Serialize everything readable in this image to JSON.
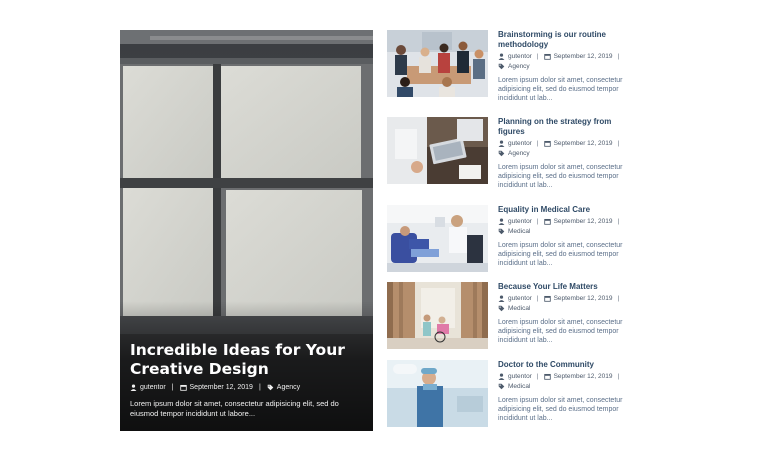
{
  "featured": {
    "title": "Incredible Ideas for Your Creative Design",
    "author": "gutentor",
    "date": "September 12, 2019",
    "category": "Agency",
    "excerpt": "Lorem ipsum dolor sit amet, consectetur adipisicing elit, sed do eiusmod tempor incididunt ut labore..."
  },
  "posts": [
    {
      "title": "Brainstorming is our routine methodology",
      "author": "gutentor",
      "date": "September 12, 2019",
      "category": "Agency",
      "excerpt": "Lorem ipsum dolor sit amet, consectetur adipisicing elit, sed do eiusmod tempor incididunt ut lab..."
    },
    {
      "title": "Planning on the strategy from figures",
      "author": "gutentor",
      "date": "September 12, 2019",
      "category": "Agency",
      "excerpt": "Lorem ipsum dolor sit amet, consectetur adipisicing elit, sed do eiusmod tempor incididunt ut lab..."
    },
    {
      "title": "Equality in Medical Care",
      "author": "gutentor",
      "date": "September 12, 2019",
      "category": "Medical",
      "excerpt": "Lorem ipsum dolor sit amet, consectetur adipisicing elit, sed do eiusmod tempor incididunt ut lab..."
    },
    {
      "title": "Because Your Life Matters",
      "author": "gutentor",
      "date": "September 12, 2019",
      "category": "Medical",
      "excerpt": "Lorem ipsum dolor sit amet, consectetur adipisicing elit, sed do eiusmod tempor incididunt ut lab..."
    },
    {
      "title": "Doctor to the Community",
      "author": "gutentor",
      "date": "September 12, 2019",
      "category": "Medical",
      "excerpt": "Lorem ipsum dolor sit amet, consectetur adipisicing elit, sed do eiusmod tempor incididunt ut lab..."
    }
  ],
  "icons": {
    "author": "user-icon",
    "date": "calendar-icon",
    "category": "tag-icon"
  },
  "colors": {
    "title_link": "#2f4a66",
    "excerpt": "#5b6f89",
    "hero_overlay": "#000000"
  }
}
